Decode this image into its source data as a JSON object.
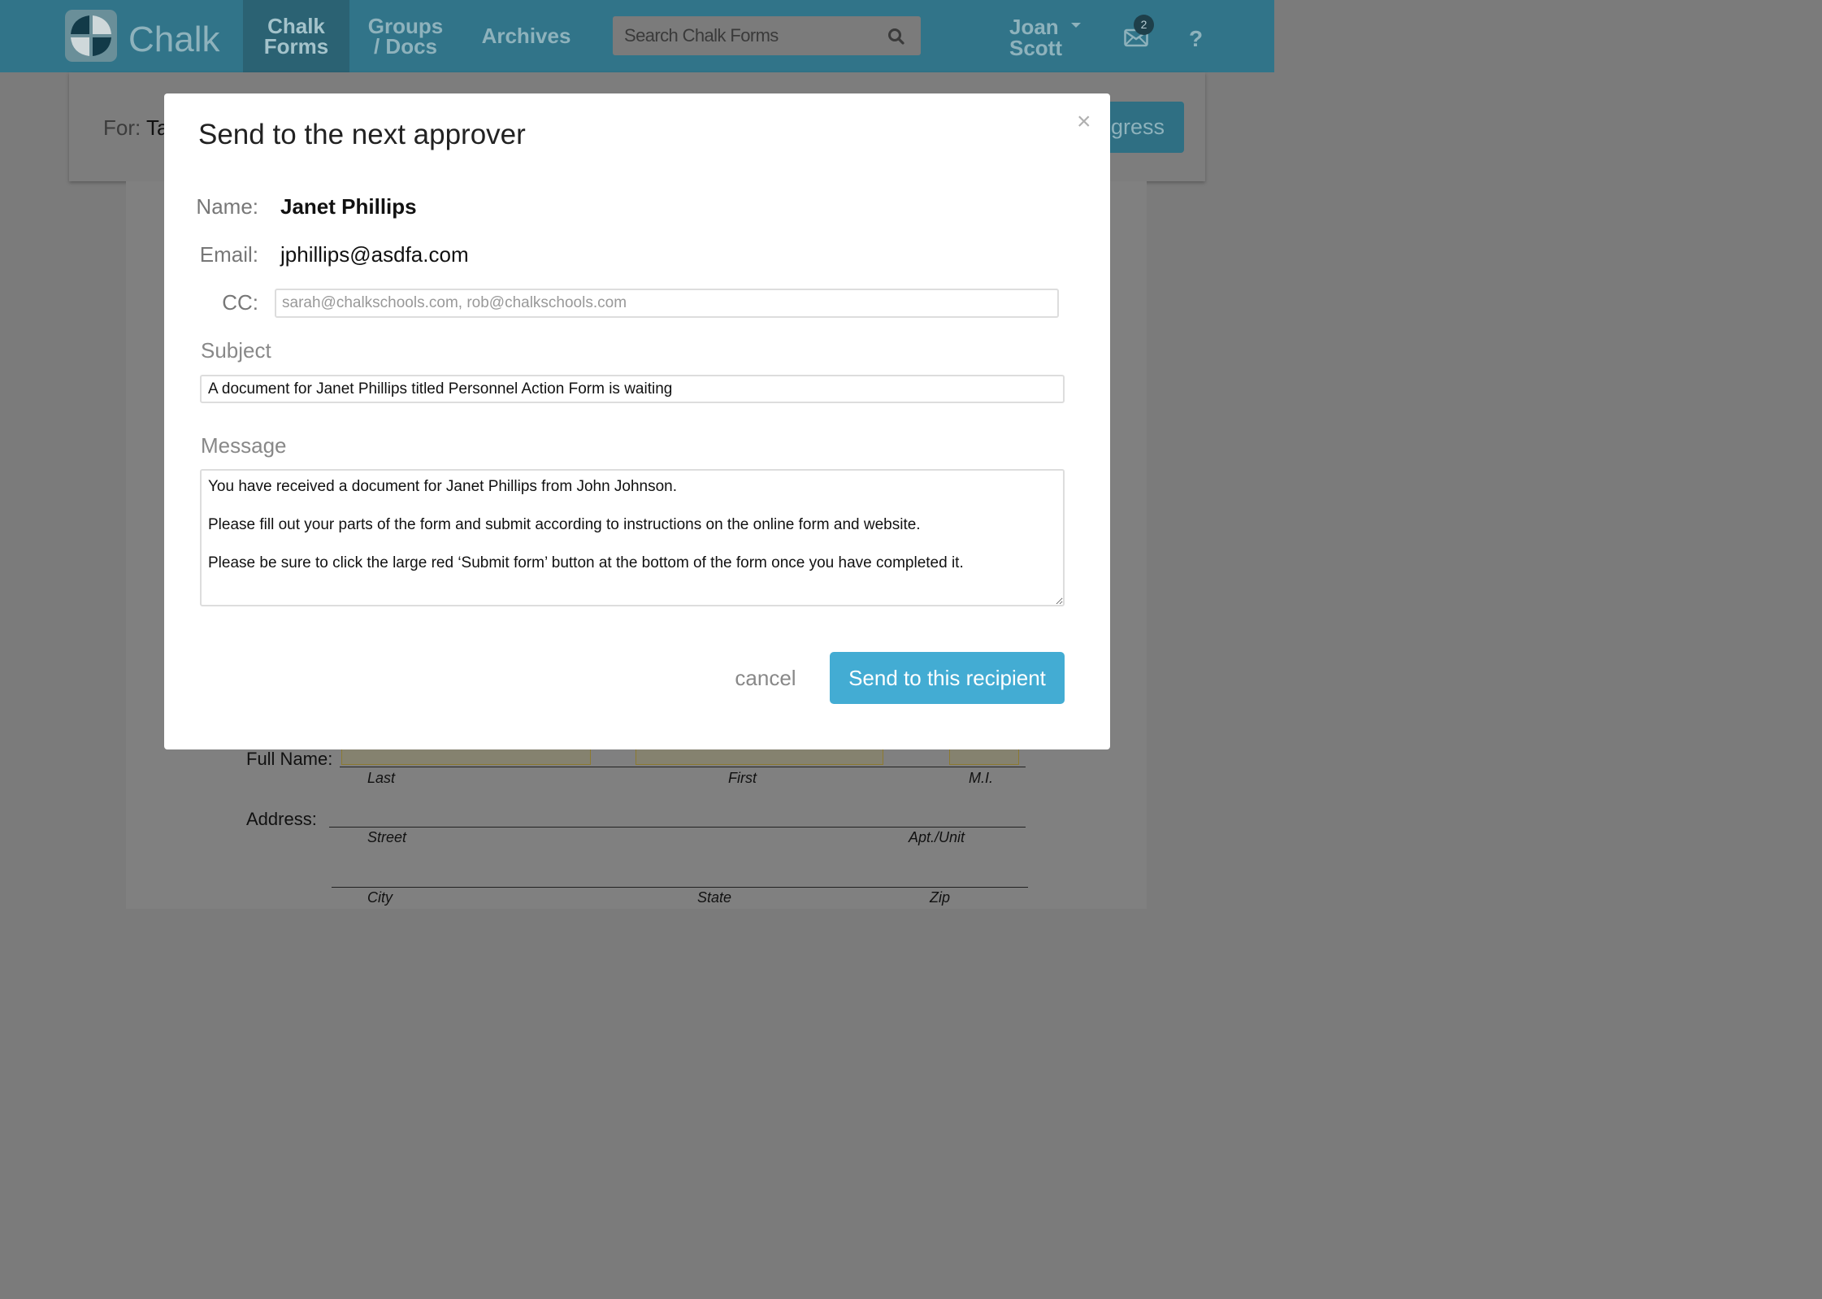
{
  "navbar": {
    "brand": "Chalk",
    "items": [
      {
        "line1": "Chalk",
        "line2": "Forms"
      },
      {
        "line1": "Groups",
        "line2": "/ Docs"
      },
      {
        "line1": "Archives"
      }
    ],
    "search_placeholder": "Search Chalk Forms",
    "user_first": "Joan",
    "user_last": "Scott",
    "notification_count": "2",
    "help": "?"
  },
  "background": {
    "for_label": "For:",
    "for_value": "Ta",
    "progress_button": "ogress",
    "form": {
      "full_name_label": "Full Name:",
      "last": "Last",
      "first": "First",
      "mi": "M.I.",
      "address_label": "Address:",
      "street": "Street",
      "apt": "Apt./Unit",
      "city": "City",
      "state": "State",
      "zip": "Zip"
    }
  },
  "modal": {
    "close": "×",
    "title": "Send to the next approver",
    "name_label": "Name:",
    "name_value": "Janet Phillips",
    "email_label": "Email:",
    "email_value": "jphillips@asdfa.com",
    "cc_label": "CC:",
    "cc_placeholder": "sarah@chalkschools.com, rob@chalkschools.com",
    "subject_label": "Subject",
    "subject_value": "A document for Janet Phillips titled Personnel Action Form is waiting",
    "message_label": "Message",
    "message_value": "You have received a document for Janet Phillips from John Johnson.\n\nPlease fill out your parts of the form and submit according to instructions on the online form and website.\n\nPlease be sure to click the large red ‘Submit form’ button at the bottom of the form once you have completed it.",
    "cancel": "cancel",
    "send": "Send to this recipient"
  }
}
